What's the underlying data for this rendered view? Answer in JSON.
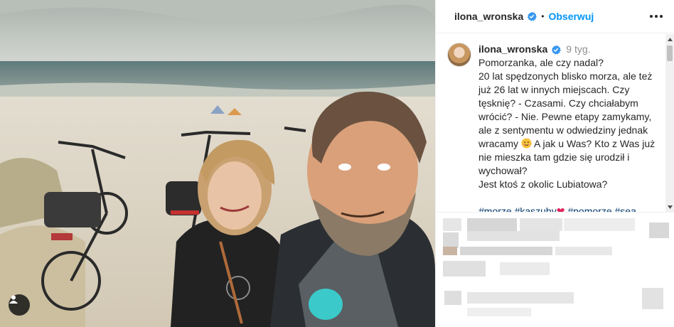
{
  "post": {
    "header": {
      "username": "ilona_wronska",
      "separator": "•",
      "follow_label": "Obserwuj"
    },
    "caption": {
      "username": "ilona_wronska",
      "time": "9 tyg.",
      "lines": [
        "Pomorzanka, ale czy nadal?",
        "20 lat spędzonych blisko morza, ale też",
        "już 26 lat w innych miejscach. Czy",
        "tęsknię? - Czasami. Czy chciałabym",
        "wrócić? - Nie. Pewne etapy zamykamy,",
        "ale z sentymentu w odwiedziny jednak",
        "wracamy",
        "A jak u Was? Kto z Was już",
        "nie mieszka tam gdzie się urodził i",
        "wychował?",
        "Jest ktoś z okolic Lubiatowa?"
      ],
      "hashtags": [
        "#morze",
        "#kaszuby",
        "#pomorze",
        "#sea"
      ]
    },
    "icons": {
      "verified": "verified-badge-icon",
      "more": "more-options-icon",
      "user_tag": "user-tag-icon",
      "smile": "smiling-face-emoji",
      "heart": "red-heart-emoji"
    },
    "colors": {
      "link": "#0095f6",
      "hashtag": "#00376b",
      "muted": "#8e8e8e"
    }
  }
}
